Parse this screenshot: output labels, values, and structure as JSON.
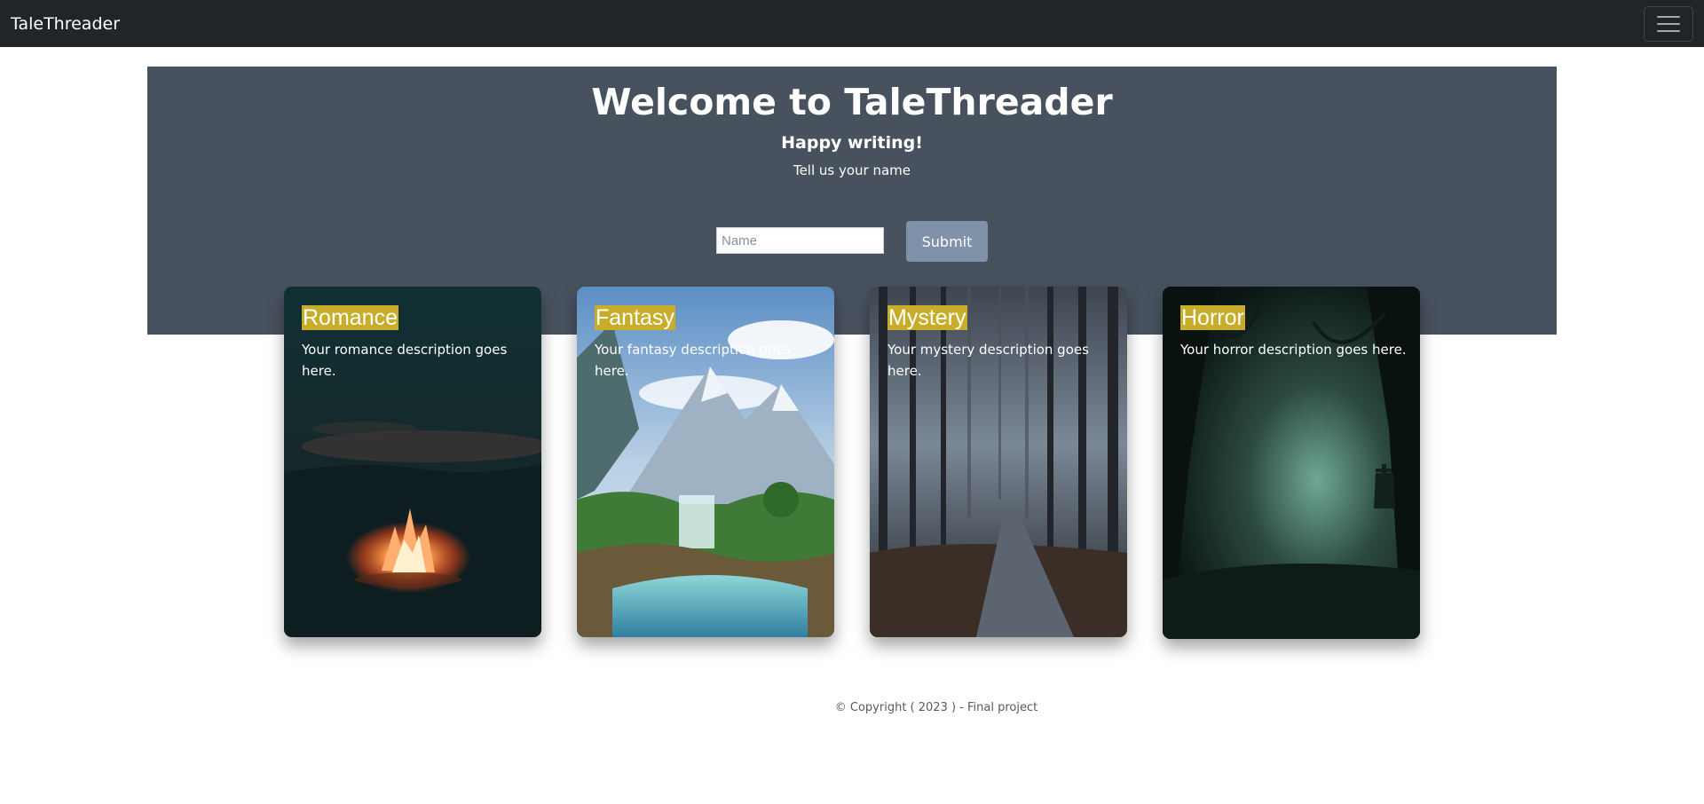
{
  "navbar": {
    "brand": "TaleThreader",
    "toggle_icon": "hamburger-menu-icon"
  },
  "hero": {
    "title": "Welcome to TaleThreader",
    "subtitle": "Happy writing!",
    "prompt": "Tell us your name",
    "name_placeholder": "Name",
    "name_value": "",
    "submit_label": "Submit"
  },
  "cards": [
    {
      "title": "Romance",
      "description": "Your romance description goes here.",
      "image": "campfire-night"
    },
    {
      "title": "Fantasy",
      "description": "Your fantasy description goes here.",
      "image": "mountain-waterfall"
    },
    {
      "title": "Mystery",
      "description": "Your mystery description goes here.",
      "image": "foggy-forest-path"
    },
    {
      "title": "Horror",
      "description": "Your horror description goes here.",
      "image": "haunted-forest-gravestone"
    }
  ],
  "footer": {
    "text": "© Copyright ( 2023 ) - Final project"
  },
  "colors": {
    "navbar_bg": "#212529",
    "hero_bg": "#48525f",
    "submit_bg": "#8091aa",
    "title_highlight": "#c8ad2a"
  }
}
